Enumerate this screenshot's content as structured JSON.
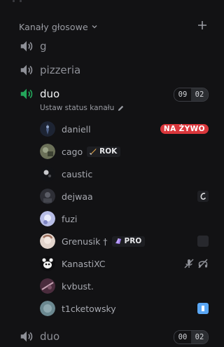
{
  "section": {
    "title": "Kanały głosowe"
  },
  "channels": [
    {
      "name": "g"
    },
    {
      "name": "pizzeria"
    },
    {
      "name": "duo",
      "count": "09",
      "limit": "02",
      "status_placeholder": "Ustaw status kanału"
    },
    {
      "name": "duo",
      "count": "00",
      "limit": "02"
    }
  ],
  "users": [
    {
      "name": "daniell",
      "badge": "NA ŻYWO"
    },
    {
      "name": "cago",
      "tag": "ROK"
    },
    {
      "name": "caustic"
    },
    {
      "name": "dejwaa"
    },
    {
      "name": "fuzi"
    },
    {
      "name": "Grenusik †",
      "tag": "PRO"
    },
    {
      "name": "KanastiXC"
    },
    {
      "name": "kvbust."
    },
    {
      "name": "t1cketowsky"
    }
  ],
  "colors": {
    "background": "#121214",
    "live_badge": "#da373c",
    "speaking": "#23a55a"
  }
}
